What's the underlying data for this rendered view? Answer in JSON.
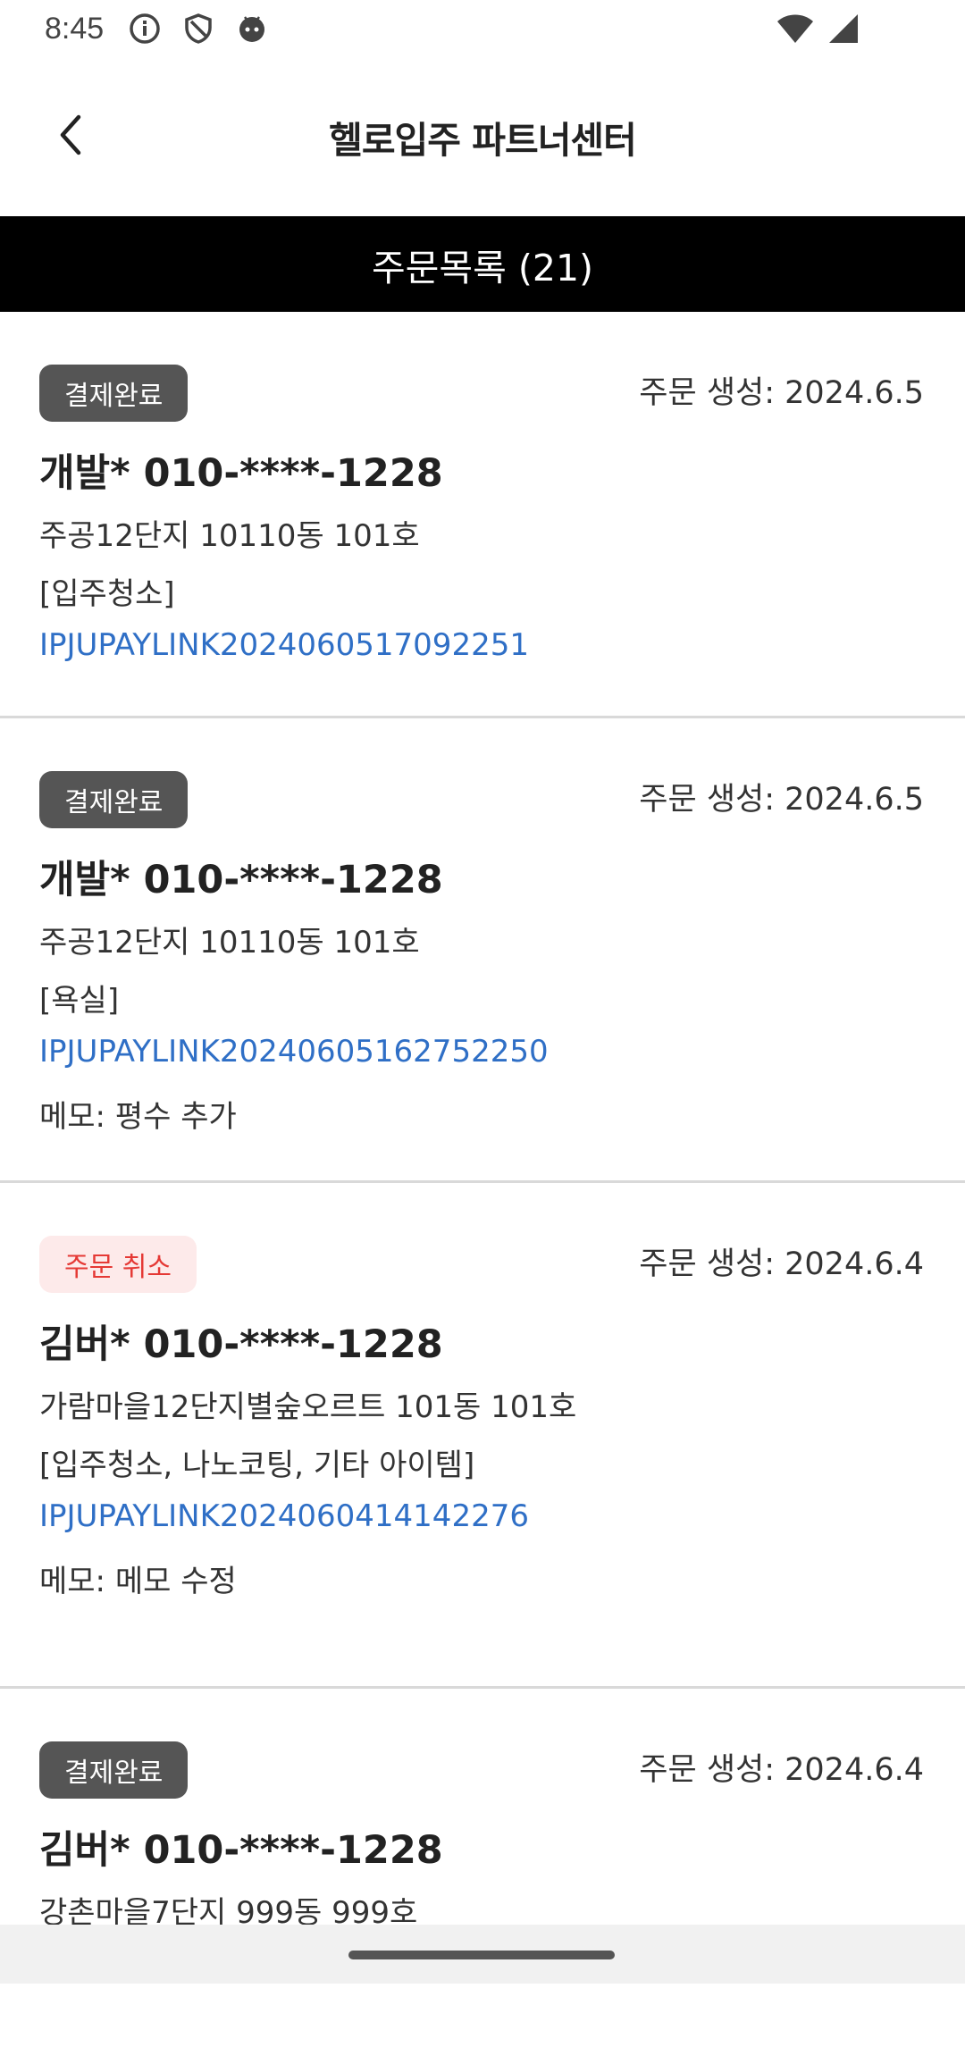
{
  "status_bar": {
    "time": "8:45",
    "icons": [
      "info-icon",
      "shield-icon",
      "android-face-icon",
      "wifi-icon",
      "signal-icon"
    ]
  },
  "header": {
    "title": "헬로입주 파트너센터",
    "back_icon": "chevron-left-icon"
  },
  "list": {
    "title": "주문목록 (21)"
  },
  "orders": [
    {
      "status": "결제완료",
      "status_type": "paid",
      "created": "주문 생성: 2024.6.5",
      "customer": "개발* 010-****-1228",
      "address": "주공12단지 10110동 101호",
      "services": "[입주청소]",
      "link": "IPJUPAYLINK2024060517092251",
      "memo": ""
    },
    {
      "status": "결제완료",
      "status_type": "paid",
      "created": "주문 생성: 2024.6.5",
      "customer": "개발* 010-****-1228",
      "address": "주공12단지 10110동 101호",
      "services": "[욕실]",
      "link": "IPJUPAYLINK20240605162752250",
      "memo": "메모: 평수 추가"
    },
    {
      "status": "주문 취소",
      "status_type": "cancel",
      "created": "주문 생성: 2024.6.4",
      "customer": "김버* 010-****-1228",
      "address": "가람마을12단지별숲오르트 101동 101호",
      "services": "[입주청소, 나노코팅, 기타 아이템]",
      "link": "IPJUPAYLINK2024060414142276",
      "memo": "메모: 메모 수정"
    },
    {
      "status": "결제완료",
      "status_type": "paid",
      "created": "주문 생성: 2024.6.4",
      "customer": "김버* 010-****-1228",
      "address": "강촌마을7단지 999동 999호",
      "services": "",
      "link": "",
      "memo": ""
    }
  ],
  "colors": {
    "paid_badge": "#555555",
    "cancel_badge_bg": "#fdeaea",
    "cancel_badge_text": "#e53935",
    "link": "#2f6fc6",
    "list_bar": "#000000"
  }
}
